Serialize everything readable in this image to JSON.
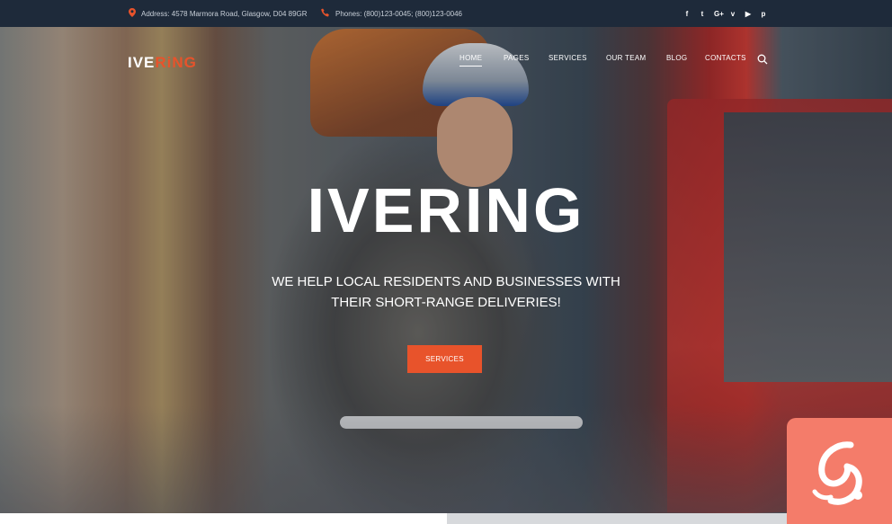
{
  "topbar": {
    "address": "Address: 4578 Marmora Road, Glasgow, D04 89GR",
    "phones": "Phones: (800)123-0045; (800)123-0046",
    "social": [
      "f",
      "t",
      "G+",
      "v",
      "▶",
      "p"
    ]
  },
  "logo": {
    "part1": "IVE",
    "part2": "RiNG"
  },
  "nav": {
    "items": [
      "HOME",
      "PAGES",
      "SERVICES",
      "OUR TEAM",
      "BLOG",
      "CONTACTS"
    ],
    "active": "HOME"
  },
  "hero": {
    "headline": "IVERING",
    "subline_1": "WE HELP LOCAL RESIDENTS AND BUSINESSES WITH",
    "subline_2": "THEIR SHORT-RANGE DELIVERIES!",
    "cta_label": "SERVICES"
  },
  "colors": {
    "accent": "#e8532b",
    "topbar": "#1e2a3a",
    "badge": "#f47c6a"
  },
  "icons": [
    "location-pin-icon",
    "phone-icon",
    "search-icon",
    "badge-logo-icon"
  ]
}
